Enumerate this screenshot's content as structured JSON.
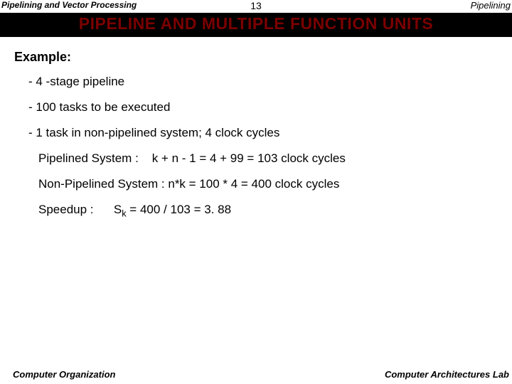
{
  "header": {
    "left": "Pipelining and Vector Processing",
    "center": "13",
    "right": "Pipelining"
  },
  "title": "PIPELINE  AND  MULTIPLE  FUNCTION  UNITS",
  "example_label": "Example:",
  "lines": {
    "l1": "- 4 -stage pipeline",
    "l2": "- 100 tasks to be executed",
    "l3": "- 1 task in non-pipelined system;  4 clock cycles",
    "l4a": "Pipelined System :",
    "l4b": "k + n - 1 = 4 + 99 = 103 clock cycles",
    "l5": "Non-Pipelined System :  n*k = 100 * 4 = 400 clock cycles",
    "l6a": "Speedup :",
    "l6b_pre": "S",
    "l6b_sub": "k",
    "l6b_post": " = 400 / 103 = 3. 88"
  },
  "footer": {
    "left": "Computer Organization",
    "right": "Computer Architectures Lab"
  }
}
